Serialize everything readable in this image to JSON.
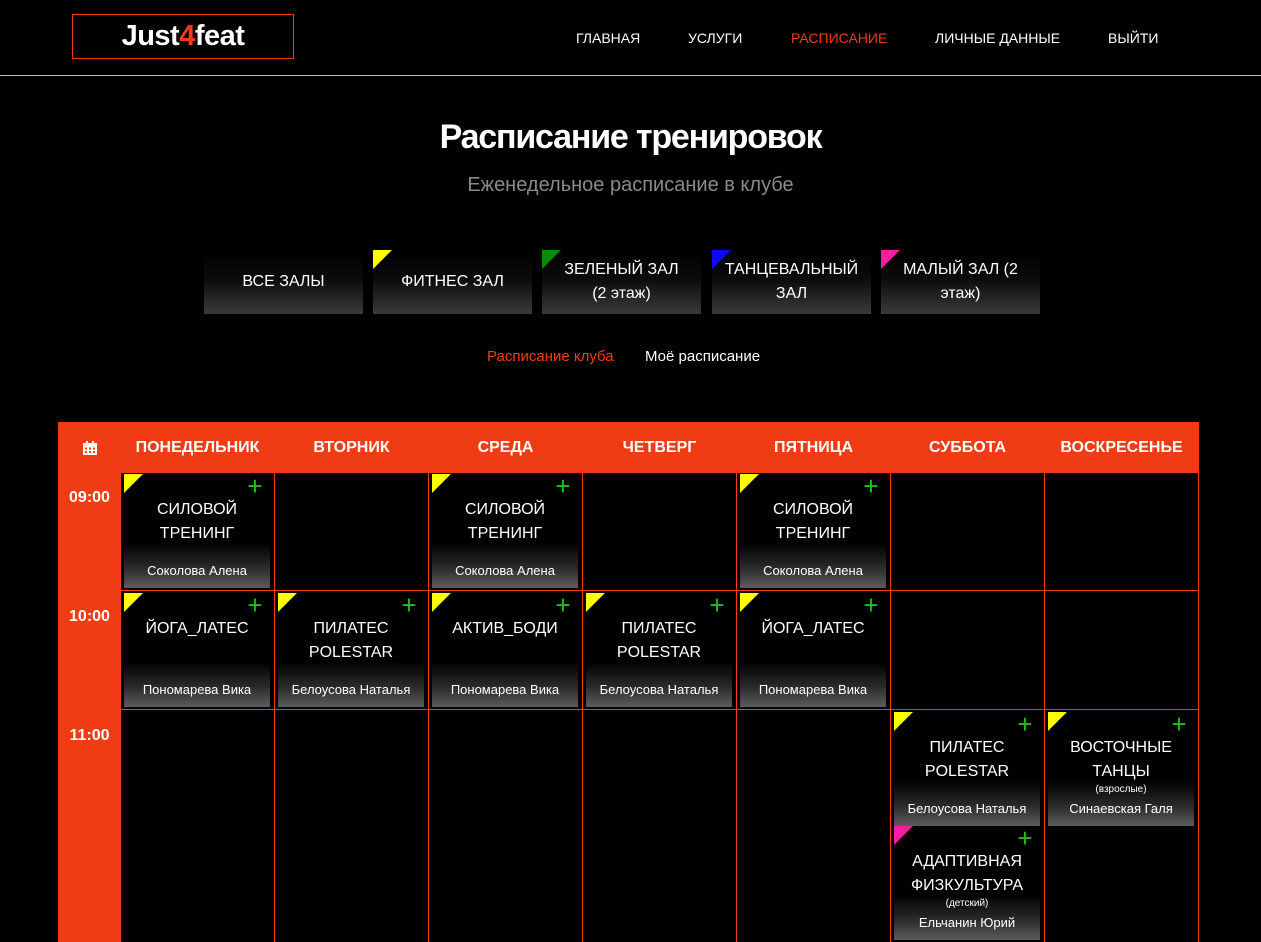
{
  "colors": {
    "accent": "#f03c14",
    "plus": "#1fbf1f",
    "yellow": "#ffff00",
    "green": "#0a8a0a",
    "blue": "#0a0aff",
    "pink": "#ff1aa8"
  },
  "logo": {
    "prefix": "Just",
    "digit": "4",
    "suffix": "feat"
  },
  "nav": [
    {
      "label": "ГЛАВНАЯ",
      "active": false
    },
    {
      "label": "УСЛУГИ",
      "active": false
    },
    {
      "label": "РАСПИСАНИЕ",
      "active": true
    },
    {
      "label": "ЛИЧНЫЕ ДАННЫЕ",
      "active": false
    },
    {
      "label": "ВЫЙТИ",
      "active": false
    }
  ],
  "page": {
    "title": "Расписание тренировок",
    "subtitle": "Еженедельное расписание в клубе"
  },
  "halls": [
    {
      "label": "ВСЕ ЗАЛЫ",
      "color": ""
    },
    {
      "label": "ФИТНЕС ЗАЛ",
      "color": "yellow"
    },
    {
      "label": "ЗЕЛЕНЫЙ ЗАЛ (2 этаж)",
      "color": "green"
    },
    {
      "label": "ТАНЦЕВАЛЬНЫЙ ЗАЛ",
      "color": "blue"
    },
    {
      "label": "МАЛЫЙ ЗАЛ (2 этаж)",
      "color": "pink"
    }
  ],
  "schedule_switch": {
    "club": "Расписание клуба",
    "mine": "Моё расписание",
    "active": "club"
  },
  "table": {
    "calendar_icon": "calendar-icon",
    "days": [
      "ПОНЕДЕЛЬНИК",
      "ВТОРНИК",
      "СРЕДА",
      "ЧЕТВЕРГ",
      "ПЯТНИЦА",
      "СУББОТА",
      "ВОСКРЕСЕНЬЕ"
    ],
    "times": [
      "09:00",
      "10:00",
      "11:00"
    ],
    "classes": [
      {
        "time": "09:00",
        "day": "ПОНЕДЕЛЬНИК",
        "name": "СИЛОВОЙ ТРЕНИНГ",
        "sub": "",
        "trainer": "Соколова Алена",
        "hall": "yellow"
      },
      {
        "time": "09:00",
        "day": "СРЕДА",
        "name": "СИЛОВОЙ ТРЕНИНГ",
        "sub": "",
        "trainer": "Соколова Алена",
        "hall": "yellow"
      },
      {
        "time": "09:00",
        "day": "ПЯТНИЦА",
        "name": "СИЛОВОЙ ТРЕНИНГ",
        "sub": "",
        "trainer": "Соколова Алена",
        "hall": "yellow"
      },
      {
        "time": "10:00",
        "day": "ПОНЕДЕЛЬНИК",
        "name": "ЙОГА_ЛАТЕС",
        "sub": "",
        "trainer": "Пономарева Вика",
        "hall": "yellow"
      },
      {
        "time": "10:00",
        "day": "ВТОРНИК",
        "name": "ПИЛАТЕС POLESTAR",
        "sub": "",
        "trainer": "Белоусова Наталья",
        "hall": "yellow"
      },
      {
        "time": "10:00",
        "day": "СРЕДА",
        "name": "АКТИВ_БОДИ",
        "sub": "",
        "trainer": "Пономарева Вика",
        "hall": "yellow"
      },
      {
        "time": "10:00",
        "day": "ЧЕТВЕРГ",
        "name": "ПИЛАТЕС POLESTAR",
        "sub": "",
        "trainer": "Белоусова Наталья",
        "hall": "yellow"
      },
      {
        "time": "10:00",
        "day": "ПЯТНИЦА",
        "name": "ЙОГА_ЛАТЕС",
        "sub": "",
        "trainer": "Пономарева Вика",
        "hall": "yellow"
      },
      {
        "time": "11:00",
        "day": "СУББОТА",
        "name": "ПИЛАТЕС POLESTAR",
        "sub": "",
        "trainer": "Белоусова Наталья",
        "hall": "yellow"
      },
      {
        "time": "11:00",
        "day": "ВОСКРЕСЕНЬЕ",
        "name": "ВОСТОЧНЫЕ ТАНЦЫ",
        "sub": "(взрослые)",
        "trainer": "Синаевская Галя",
        "hall": "yellow"
      },
      {
        "time": "11:00",
        "day": "СУББОТА",
        "name": "АДАПТИВНАЯ ФИЗКУЛЬТУРА",
        "sub": "(детский)",
        "trainer": "Ельчанин Юрий",
        "hall": "pink"
      }
    ]
  }
}
